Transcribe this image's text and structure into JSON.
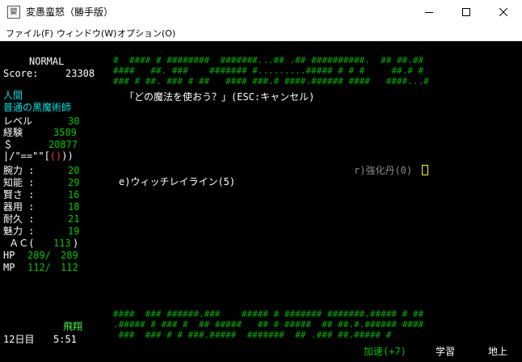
{
  "window": {
    "title": "変愚蛮怒（勝手版）",
    "icon_text": "變"
  },
  "menu": [
    "ファイル(F)",
    "ウィンドウ(W)",
    "オプション(O)"
  ],
  "sidebar": {
    "difficulty": "NORMAL",
    "score_label": "Score:",
    "score_value": "23308",
    "race": "人間",
    "class": "普通の黒魔術師",
    "level_label": "レベル",
    "level_value": "30",
    "exp_label": "経験",
    "exp_value": "3509",
    "gold_label": "＄",
    "gold_value": "20877",
    "equip_line": "|/\"==\"\"[",
    "equip_red": "()",
    "equip_end": "))",
    "stats": [
      {
        "label": "腕力 :",
        "value": "20"
      },
      {
        "label": "知能 :",
        "value": "29"
      },
      {
        "label": "賢さ :",
        "value": "16"
      },
      {
        "label": "器用 :",
        "value": "18"
      },
      {
        "label": "耐久 :",
        "value": "21"
      },
      {
        "label": "魅力 :",
        "value": "19"
      }
    ],
    "ac_label": " ＡＣ(",
    "ac_value": "113",
    "ac_end": ")",
    "hp_label": "HP",
    "hp_cur": "289/",
    "hp_max": "289",
    "mp_label": "MP",
    "mp_cur": "112/",
    "mp_max": "112"
  },
  "prompt": "「どの魔法を使おう？」(ESC:キャンセル)",
  "spell_option": "e)ウィッチレイライン(5)",
  "item_option": "r)強化丹(0)",
  "status_bar": {
    "flying": "飛翔",
    "day": "12日目",
    "time": "5:51",
    "speed": "加速(+7)",
    "study": "学習",
    "location": "地上"
  },
  "map_rows_top": [
    "#  #### # ########  #######...## .## ##########.  ## ##.##",
    "####   ##. ###    ####### #.........##### # # #     ##.# #",
    "### # ##. ### # ##   #### ###.# ####.###### ####   ####...#"
  ],
  "map_rows_bottom": [
    "####  ### ######.###    ##### # ####### #######.##### # ##",
    ".##### # ### #  ## #####   ## # #####  ## ##.#.###### ####",
    " ###  ### # # ###.#####  #######  ## .### ##.##### #      "
  ],
  "colors": {
    "screen_bg": "#000000",
    "text_white": "#ffffff",
    "text_green": "#00c800",
    "text_cyan": "#00e0e0",
    "text_gray": "#8a8a8a",
    "text_red": "#ff3030",
    "cursor": "#ffff00"
  }
}
